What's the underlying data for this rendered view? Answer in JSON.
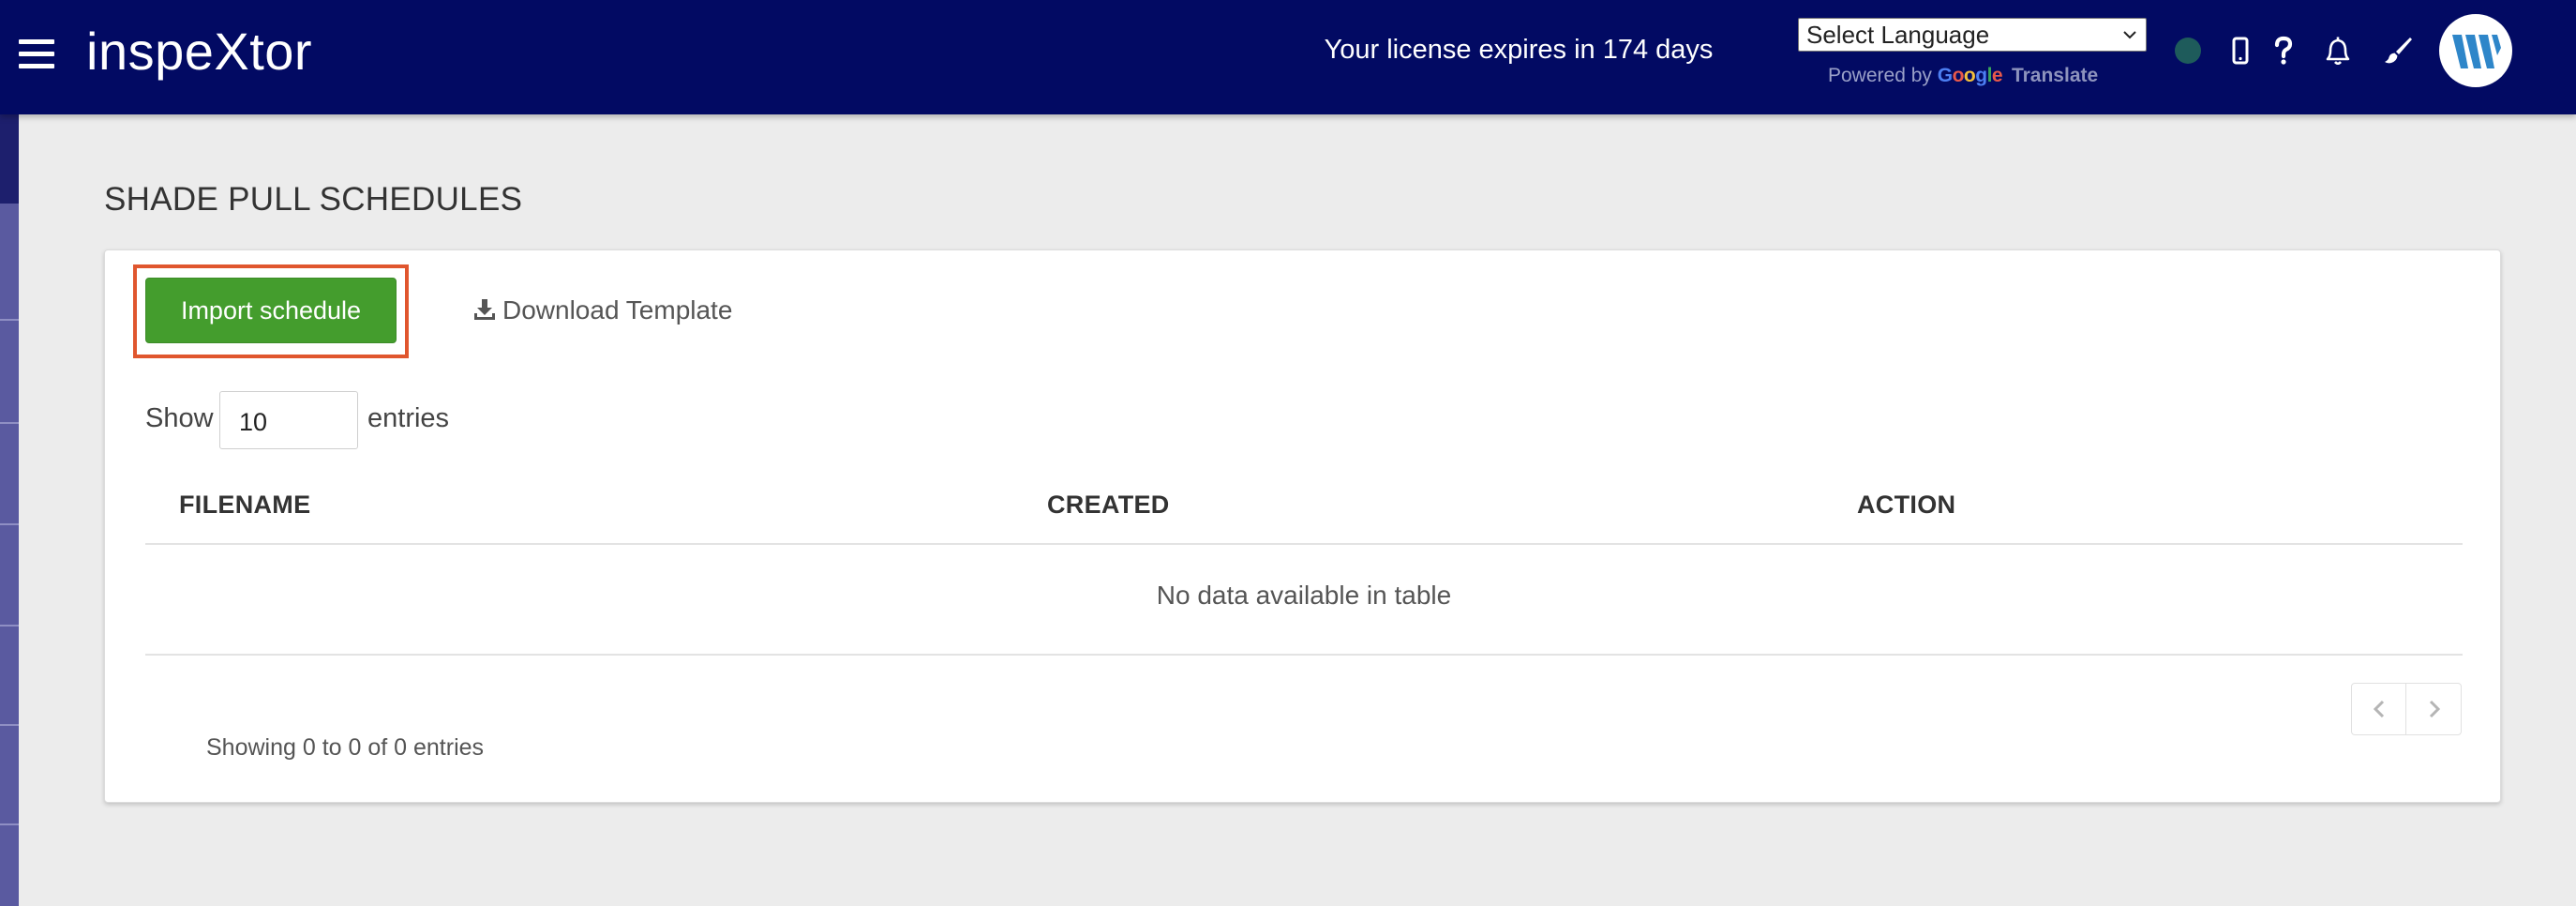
{
  "header": {
    "brand": "inspeXtor",
    "license_text": "Your license expires in 174 days",
    "language_select": "Select Language",
    "powered_by": "Powered by",
    "google_letters": [
      "G",
      "o",
      "o",
      "g",
      "l",
      "e"
    ],
    "translate": "Translate",
    "status_color": "#1e5b5b"
  },
  "page": {
    "title": "SHADE PULL SCHEDULES"
  },
  "toolbar": {
    "import_label": "Import schedule",
    "download_label": "Download Template"
  },
  "table": {
    "show_label": "Show",
    "page_length": "10",
    "entries_label": "entries",
    "columns": [
      "FILENAME",
      "CREATED",
      "ACTION"
    ],
    "empty_message": "No data available in table",
    "info": "Showing 0 to 0 of 0 entries"
  },
  "colors": {
    "topbar": "#020a63",
    "primary_button": "#449d2d",
    "highlight": "#e0562e",
    "background": "#ececec"
  }
}
